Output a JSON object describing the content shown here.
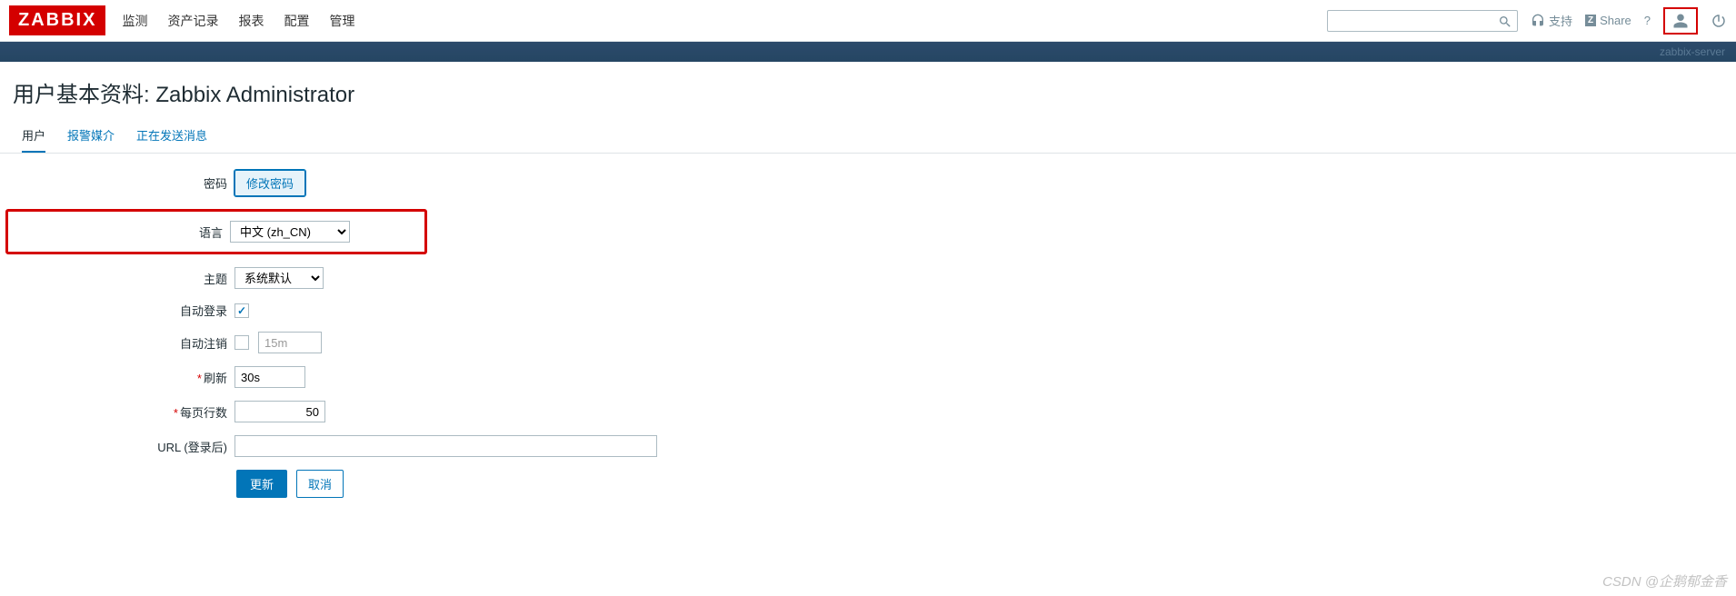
{
  "header": {
    "logo": "ZABBIX",
    "nav": [
      "监测",
      "资产记录",
      "报表",
      "配置",
      "管理"
    ],
    "support": "支持",
    "share": "Share",
    "help": "?",
    "server_name": "zabbix-server"
  },
  "page": {
    "title": "用户基本资料: Zabbix Administrator"
  },
  "tabs": {
    "items": [
      "用户",
      "报警媒介",
      "正在发送消息"
    ],
    "active": 0
  },
  "form": {
    "password_label": "密码",
    "password_btn": "修改密码",
    "language_label": "语言",
    "language_value": "中文 (zh_CN)",
    "theme_label": "主题",
    "theme_value": "系统默认",
    "auto_login_label": "自动登录",
    "auto_login_checked": true,
    "auto_logout_label": "自动注销",
    "auto_logout_checked": false,
    "auto_logout_value": "15m",
    "refresh_label": "刷新",
    "refresh_value": "30s",
    "rows_label": "每页行数",
    "rows_value": "50",
    "url_label": "URL (登录后)",
    "url_value": "",
    "submit": "更新",
    "cancel": "取消"
  },
  "watermark": "CSDN @企鹅郁金香"
}
